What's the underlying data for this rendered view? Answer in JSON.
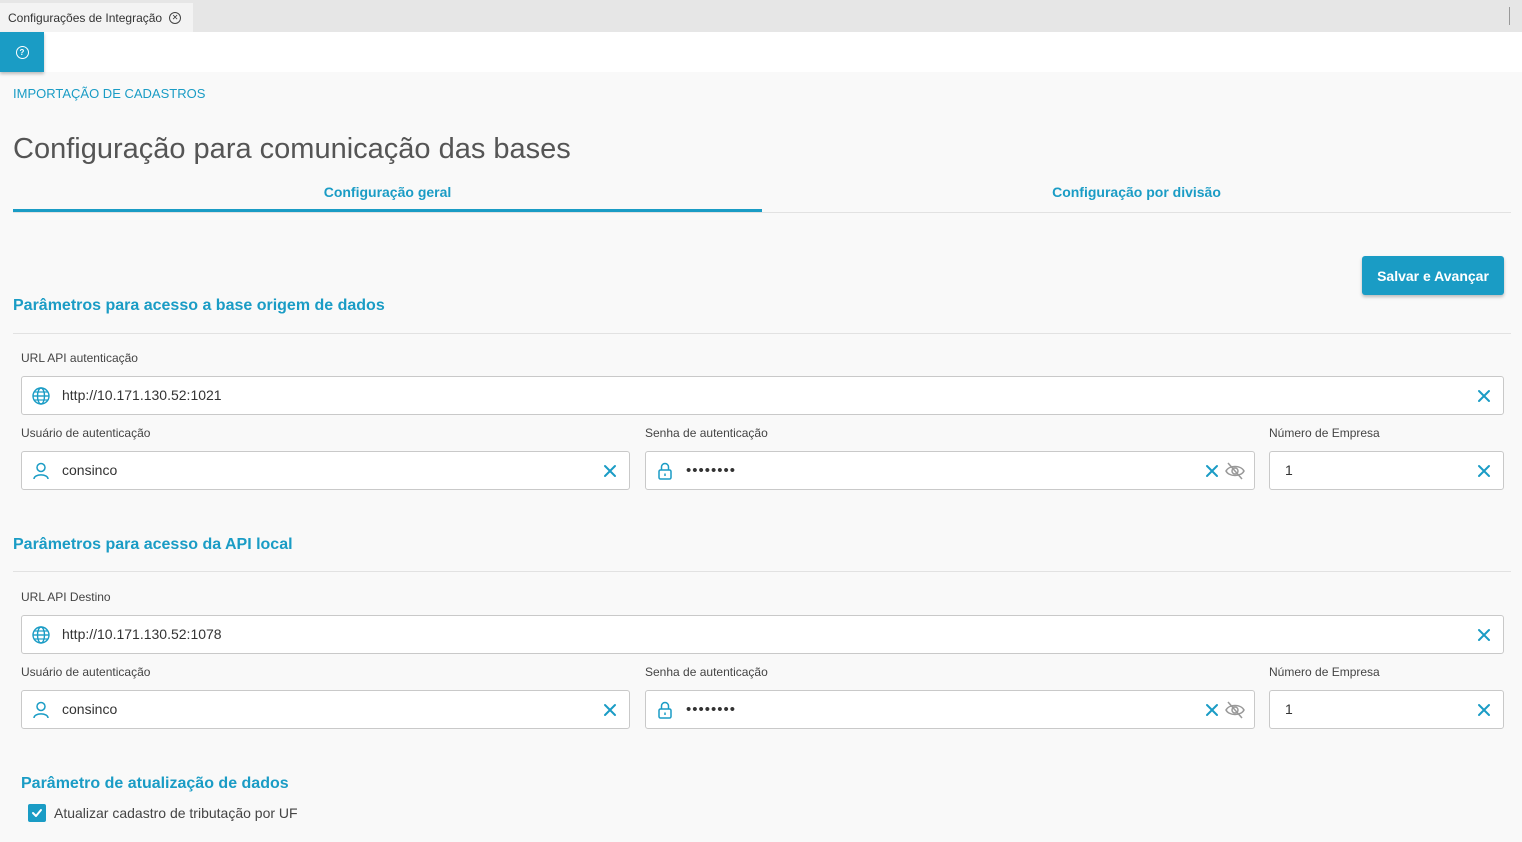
{
  "tab_title": "Configurações de Integração",
  "breadcrumb": "IMPORTAÇÃO DE CADASTROS",
  "page_title": "Configuração para comunicação das bases",
  "tabs": [
    {
      "label": "Configuração geral",
      "active": true
    },
    {
      "label": "Configuração por divisão",
      "active": false
    }
  ],
  "save_button": "Salvar e Avançar",
  "origin": {
    "title": "Parâmetros para acesso a base origem de dados",
    "url_label": "URL API autenticação",
    "url_value": "http://10.171.130.52:1021",
    "user_label": "Usuário de autenticação",
    "user_value": "consinco",
    "password_label": "Senha de autenticação",
    "password_value": "••••••••",
    "company_label": "Número de Empresa",
    "company_value": "1"
  },
  "local": {
    "title": "Parâmetros para acesso da API local",
    "url_label": "URL API Destino",
    "url_value": "http://10.171.130.52:1078",
    "user_label": "Usuário de autenticação",
    "user_value": "consinco",
    "password_label": "Senha de autenticação",
    "password_value": "••••••••",
    "company_label": "Número de Empresa",
    "company_value": "1"
  },
  "update": {
    "title": "Parâmetro de atualização de dados",
    "checkbox_label": "Atualizar cadastro de tributação por UF",
    "checked": true
  },
  "colors": {
    "accent": "#1a9cc5",
    "background": "#f9f9f9",
    "text": "#333333"
  }
}
